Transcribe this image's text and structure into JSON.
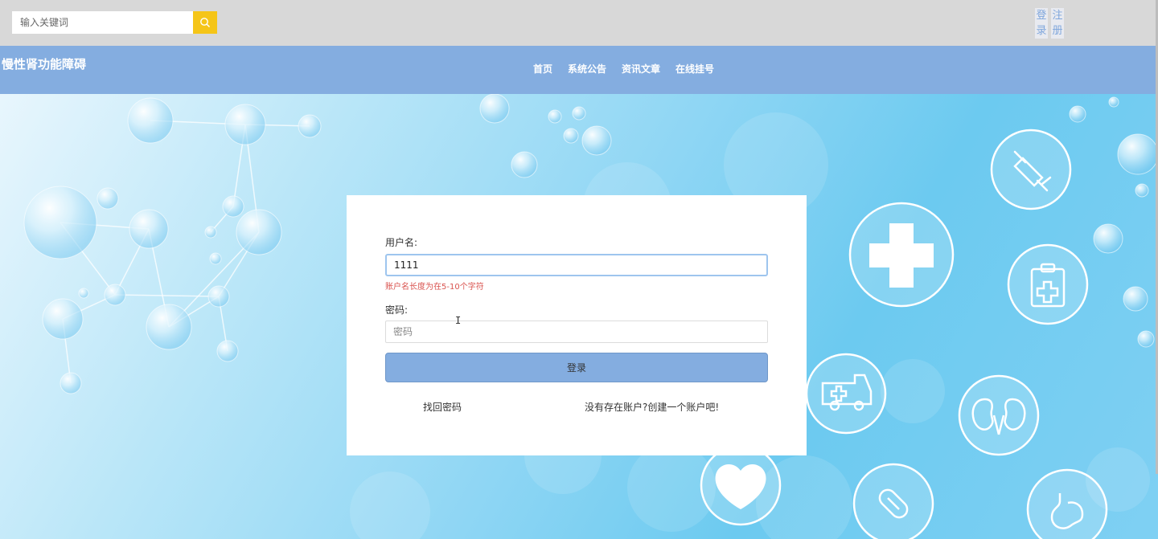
{
  "topbar": {
    "search_placeholder": "输入关键词",
    "search_icon": "search-icon",
    "login_label": "登录",
    "register_label": "注册"
  },
  "navbar": {
    "site_title": "慢性肾功能障碍",
    "links": [
      "首页",
      "系统公告",
      "资讯文章",
      "在线挂号"
    ]
  },
  "login_form": {
    "username_label": "用户名:",
    "username_value": "1111",
    "username_error": "账户名长度为在5-10个字符",
    "password_label": "密码:",
    "password_placeholder": "密码",
    "login_button": "登录",
    "forgot_password": "找回密码",
    "register_prompt": "没有存在账户?创建一个账户吧!"
  },
  "hero_icons": [
    "syringe-icon",
    "medical-cross-icon",
    "clipboard-icon",
    "ambulance-icon",
    "kidney-icon",
    "heart-icon",
    "pill-icon",
    "stomach-icon"
  ],
  "colors": {
    "nav_bg": "#84ade0",
    "search_btn": "#f5c518",
    "error": "#d9534f",
    "topbar_bg": "#d8d8d8"
  }
}
